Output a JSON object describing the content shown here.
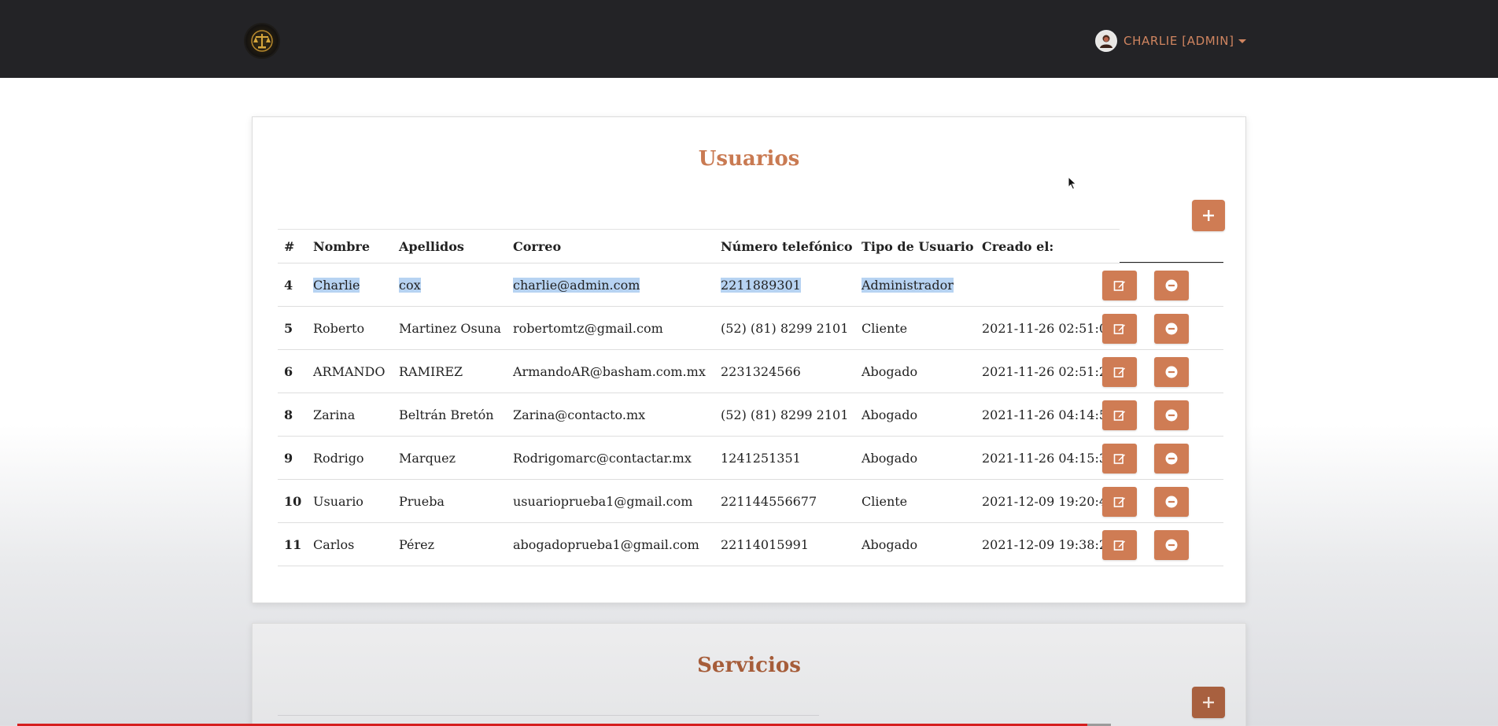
{
  "navbar": {
    "logo_icon": "scales-of-justice-logo",
    "user": {
      "avatar_icon": "user-avatar",
      "name": "CHARLIE [ADMIN]"
    }
  },
  "users_section": {
    "title": "Usuarios",
    "add_button_icon": "plus-icon",
    "columns": [
      "#",
      "Nombre",
      "Apellidos",
      "Correo",
      "Número telefónico",
      "Tipo de Usuario",
      "Creado el:"
    ],
    "rows": [
      {
        "id": "4",
        "nombre": "Charlie",
        "apellidos": "cox",
        "correo": "charlie@admin.com",
        "telefono": "2211889301",
        "tipo": "Administrador",
        "creado": "",
        "selected": true
      },
      {
        "id": "5",
        "nombre": "Roberto",
        "apellidos": "Martinez Osuna",
        "correo": "robertomtz@gmail.com",
        "telefono": "(52) (81) 8299 2101",
        "tipo": "Cliente",
        "creado": "2021-11-26 02:51:04"
      },
      {
        "id": "6",
        "nombre": "ARMANDO",
        "apellidos": "RAMIREZ",
        "correo": "ArmandoAR@basham.com.mx",
        "telefono": "2231324566",
        "tipo": "Abogado",
        "creado": "2021-11-26 02:51:23"
      },
      {
        "id": "8",
        "nombre": "Zarina",
        "apellidos": "Beltrán Bretón",
        "correo": "Zarina@contacto.mx",
        "telefono": "(52) (81) 8299 2101",
        "tipo": "Abogado",
        "creado": "2021-11-26 04:14:52"
      },
      {
        "id": "9",
        "nombre": "Rodrigo",
        "apellidos": "Marquez",
        "correo": "Rodrigomarc@contactar.mx",
        "telefono": "1241251351",
        "tipo": "Abogado",
        "creado": "2021-11-26 04:15:35"
      },
      {
        "id": "10",
        "nombre": "Usuario",
        "apellidos": "Prueba",
        "correo": "usuarioprueba1@gmail.com",
        "telefono": "221144556677",
        "tipo": "Cliente",
        "creado": "2021-12-09 19:20:46"
      },
      {
        "id": "11",
        "nombre": "Carlos",
        "apellidos": "Pérez",
        "correo": "abogadoprueba1@gmail.com",
        "telefono": "22114015991",
        "tipo": "Abogado",
        "creado": "2021-12-09 19:38:24"
      }
    ],
    "row_action_icons": {
      "edit": "edit-icon",
      "delete": "remove-icon"
    }
  },
  "services_section": {
    "title": "Servicios",
    "add_button_icon": "plus-icon"
  },
  "colors": {
    "navbar_bg": "#232326",
    "accent": "#cf7c54",
    "title": "#c97a52",
    "selection": "#b7d3f2",
    "progress": "#d51f1f"
  }
}
